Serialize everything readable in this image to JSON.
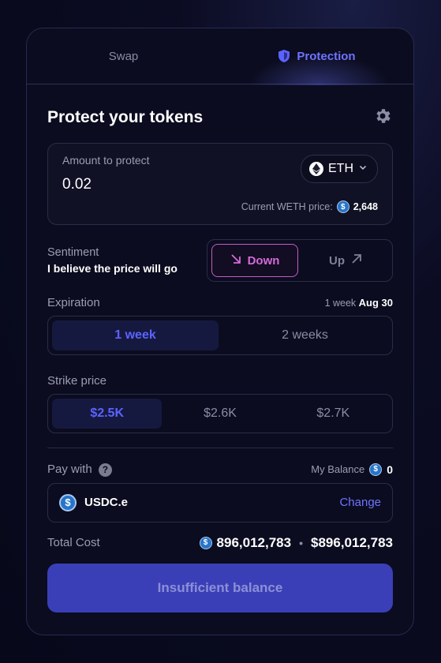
{
  "tabs": [
    {
      "label": "Swap",
      "active": false
    },
    {
      "label": "Protection",
      "active": true,
      "icon": "shield-icon"
    }
  ],
  "title": "Protect your tokens",
  "amount": {
    "label": "Amount to protect",
    "value": "0.02",
    "token": "ETH",
    "price_label": "Current WETH price:",
    "price_value": "2,648"
  },
  "sentiment": {
    "label": "Sentiment",
    "sub": "I believe the price will go",
    "down_label": "Down",
    "up_label": "Up",
    "selected": "Down"
  },
  "expiration": {
    "label": "Expiration",
    "meta_duration": "1 week",
    "meta_date": "Aug 30",
    "options": [
      "1 week",
      "2 weeks"
    ],
    "selected": "1 week"
  },
  "strike": {
    "label": "Strike price",
    "options": [
      "$2.5K",
      "$2.6K",
      "$2.7K"
    ],
    "selected": "$2.5K"
  },
  "pay": {
    "label": "Pay with",
    "help": "?",
    "balance_label": "My Balance",
    "balance_value": "0",
    "token": "USDC.e",
    "change_label": "Change"
  },
  "total": {
    "label": "Total Cost",
    "token_amount": "896,012,783",
    "usd_amount": "$896,012,783"
  },
  "cta_label": "Insufficient balance",
  "colors": {
    "accent": "#6e74ff",
    "down": "#d46ad8",
    "cta": "#3a3fb8",
    "background": "#0b0c1f"
  }
}
